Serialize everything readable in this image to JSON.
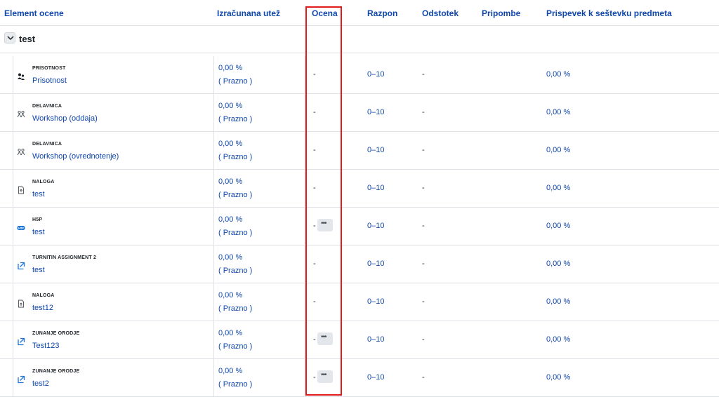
{
  "columns": {
    "item": "Element ocene",
    "weight": "Izračunana utež",
    "grade": "Ocena",
    "range": "Razpon",
    "percent": "Odstotek",
    "feedback": "Pripombe",
    "contribution": "Prispevek k seštevku predmeta"
  },
  "category": {
    "name": "test",
    "toggle_icon": "chevron-down-icon"
  },
  "rows": [
    {
      "type": "PRISOTNOST",
      "name": "Prisotnost",
      "icon": "attendance-icon",
      "weight": "0,00 %",
      "status": "( Prazno )",
      "grade": "-",
      "has_menu": false,
      "range": "0–10",
      "percent": "-",
      "contribution": "0,00 %"
    },
    {
      "type": "DELAVNICA",
      "name": "Workshop (oddaja)",
      "icon": "workshop-icon",
      "weight": "0,00 %",
      "status": "( Prazno )",
      "grade": "-",
      "has_menu": false,
      "range": "0–10",
      "percent": "-",
      "contribution": "0,00 %"
    },
    {
      "type": "DELAVNICA",
      "name": "Workshop (ovrednotenje)",
      "icon": "workshop-icon",
      "weight": "0,00 %",
      "status": "( Prazno )",
      "grade": "-",
      "has_menu": false,
      "range": "0–10",
      "percent": "-",
      "contribution": "0,00 %"
    },
    {
      "type": "NALOGA",
      "name": "test",
      "icon": "assignment-icon",
      "weight": "0,00 %",
      "status": "( Prazno )",
      "grade": "-",
      "has_menu": false,
      "range": "0–10",
      "percent": "-",
      "contribution": "0,00 %"
    },
    {
      "type": "H5P",
      "name": "test",
      "icon": "h5p-icon",
      "weight": "0,00 %",
      "status": "( Prazno )",
      "grade": "-",
      "has_menu": true,
      "range": "0–10",
      "percent": "-",
      "contribution": "0,00 %"
    },
    {
      "type": "TURNITIN ASSIGNMENT 2",
      "name": "test",
      "icon": "external-tool-icon",
      "weight": "0,00 %",
      "status": "( Prazno )",
      "grade": "-",
      "has_menu": false,
      "range": "0–10",
      "percent": "-",
      "contribution": "0,00 %"
    },
    {
      "type": "NALOGA",
      "name": "test12",
      "icon": "assignment-icon",
      "weight": "0,00 %",
      "status": "( Prazno )",
      "grade": "-",
      "has_menu": false,
      "range": "0–10",
      "percent": "-",
      "contribution": "0,00 %"
    },
    {
      "type": "ZUNANJE ORODJE",
      "name": "Test123",
      "icon": "external-tool-icon",
      "weight": "0,00 %",
      "status": "( Prazno )",
      "grade": "-",
      "has_menu": true,
      "range": "0–10",
      "percent": "-",
      "contribution": "0,00 %"
    },
    {
      "type": "ZUNANJE ORODJE",
      "name": "test2",
      "icon": "external-tool-icon",
      "weight": "0,00 %",
      "status": "( Prazno )",
      "grade": "-",
      "has_menu": true,
      "range": "0–10",
      "percent": "-",
      "contribution": "0,00 %"
    }
  ],
  "menu_button_glyph": "•••",
  "colors": {
    "link": "#0f47ad",
    "highlight": "#e01b1b",
    "border": "#dee2e6"
  }
}
